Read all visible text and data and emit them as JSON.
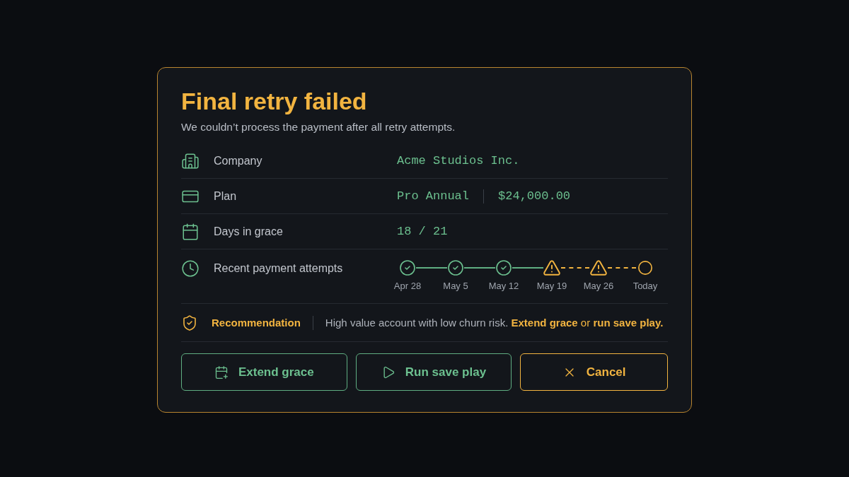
{
  "dialog": {
    "title": "Final retry failed",
    "subtitle": "We couldn’t process the payment after all retry attempts."
  },
  "rows": [
    {
      "kind": "company",
      "label": "Company",
      "values": [
        "Acme Studios Inc."
      ]
    },
    {
      "kind": "plan",
      "label": "Plan",
      "values": [
        "Pro Annual",
        "$24,000.00"
      ]
    },
    {
      "kind": "days",
      "label": "Days in grace",
      "values": [
        "18 / 21"
      ]
    }
  ],
  "attempts": {
    "label": "Recent payment attempts",
    "items": [
      {
        "kind": "success",
        "date": "Apr 28"
      },
      {
        "kind": "success",
        "date": "May 5"
      },
      {
        "kind": "success",
        "date": "May 12"
      },
      {
        "kind": "warning",
        "date": "May 19"
      },
      {
        "kind": "warning",
        "date": "May 26"
      },
      {
        "kind": "pending",
        "date": "Today"
      }
    ]
  },
  "recommendation": {
    "label": "Recommendation",
    "text": "High value account with low churn risk.",
    "action": "**Extend grace** or **run save play.**"
  },
  "buttons": [
    {
      "kind": "extend",
      "label": "Extend grace"
    },
    {
      "kind": "play",
      "label": "Run save play"
    },
    {
      "kind": "cancel",
      "label": "Cancel"
    }
  ]
}
